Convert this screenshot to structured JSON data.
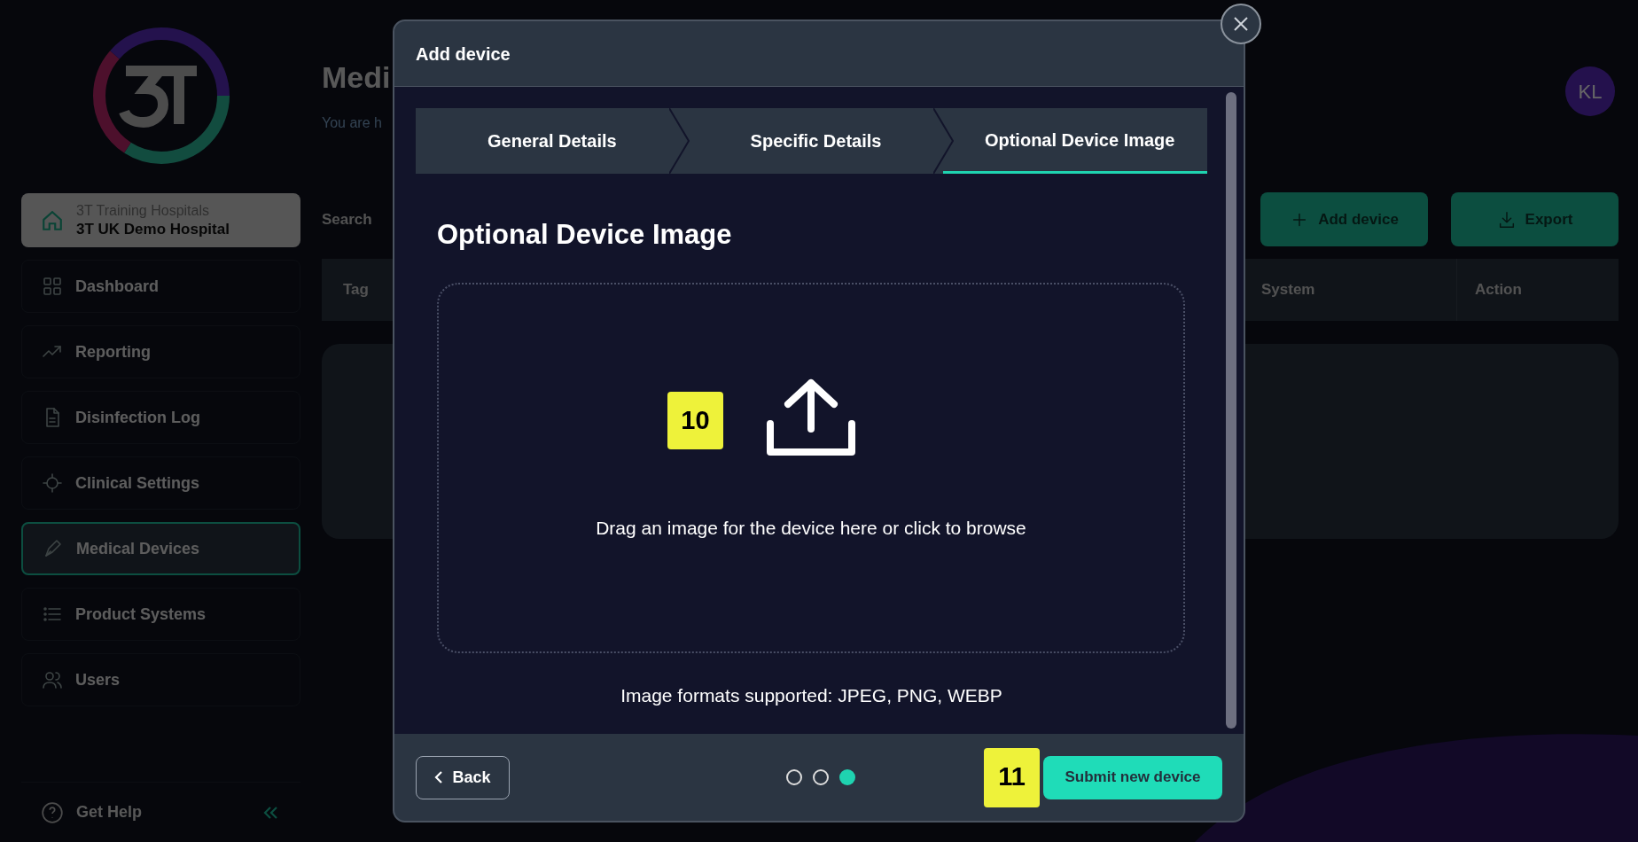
{
  "sidebar": {
    "hospital": {
      "group": "3T Training Hospitals",
      "name": "3T UK Demo Hospital"
    },
    "items": [
      {
        "label": "Dashboard",
        "selected": false
      },
      {
        "label": "Reporting",
        "selected": false
      },
      {
        "label": "Disinfection Log",
        "selected": false
      },
      {
        "label": "Clinical Settings",
        "selected": false
      },
      {
        "label": "Medical Devices",
        "selected": true
      },
      {
        "label": "Product Systems",
        "selected": false
      },
      {
        "label": "Users",
        "selected": false
      }
    ],
    "help": "Get Help"
  },
  "page": {
    "title": "Medi",
    "subtitle": "You are h",
    "search_label": "Search",
    "avatar": "KL",
    "buttons": [
      {
        "label": "Add device"
      },
      {
        "label": "Export"
      }
    ],
    "table": {
      "columns": [
        "Tag",
        "System",
        "Action"
      ]
    }
  },
  "modal": {
    "title": "Add device",
    "steps": [
      {
        "label": "General Details",
        "selected": false
      },
      {
        "label": "Specific Details",
        "selected": false
      },
      {
        "label": "Optional Device Image",
        "selected": true
      }
    ],
    "heading": "Optional Device Image",
    "dropzone": {
      "text": "Drag an image for the device here or click to browse"
    },
    "formats": "Image formats supported: JPEG, PNG, WEBP",
    "back": "Back",
    "pager": [
      {
        "selected": false
      },
      {
        "selected": false
      },
      {
        "selected": true
      }
    ],
    "submit": "Submit new device"
  },
  "callouts": [
    {
      "label": "10"
    },
    {
      "label": "11"
    }
  ]
}
